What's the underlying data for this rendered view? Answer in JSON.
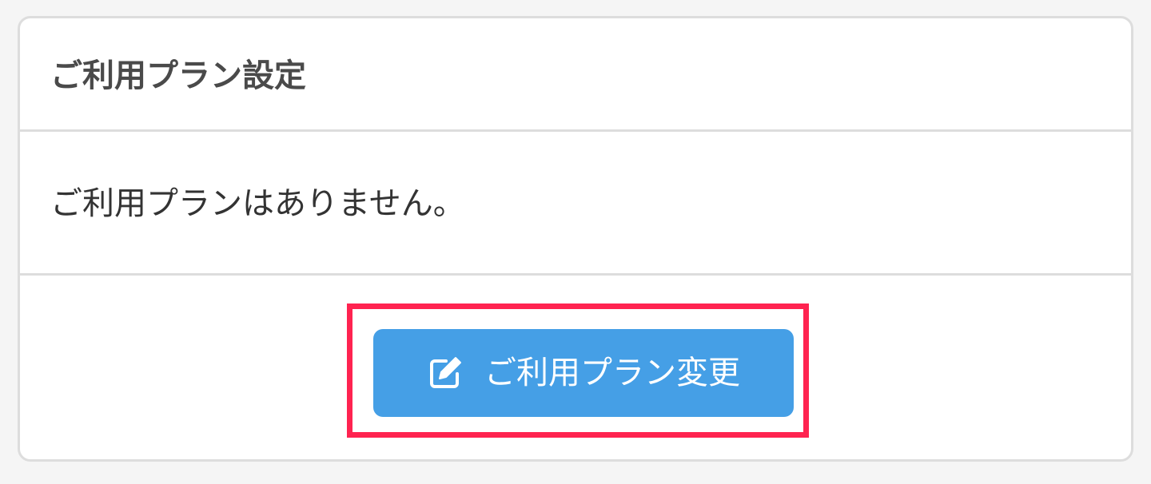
{
  "panel": {
    "title": "ご利用プラン設定",
    "message": "ご利用プランはありません。"
  },
  "actions": {
    "change_plan_label": "ご利用プラン変更",
    "change_plan_icon": "edit-icon",
    "button_color": "#459fe6",
    "highlight_color": "#ff2350"
  }
}
